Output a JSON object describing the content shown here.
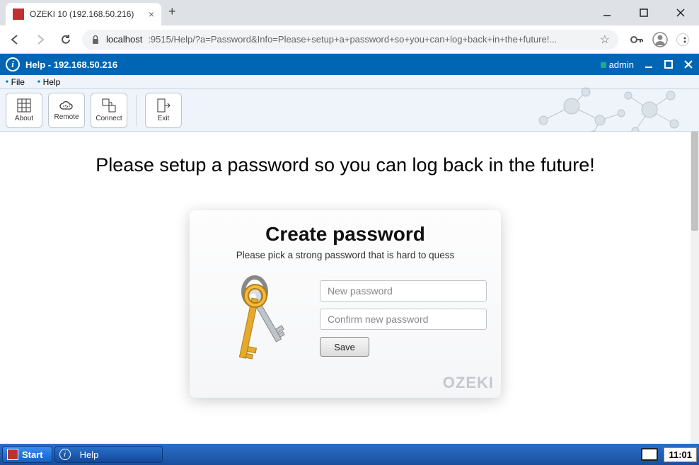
{
  "browser": {
    "tab_title": "OZEKI 10 (192.168.50.216)",
    "url_host": "localhost",
    "url_port": ":9515",
    "url_path": "/Help/?a=Password&Info=Please+setup+a+password+so+you+can+log+back+in+the+future!..."
  },
  "app_header": {
    "title": "Help - 192.168.50.216",
    "user": "admin"
  },
  "menu": {
    "file": "File",
    "help": "Help"
  },
  "toolbar": {
    "about": "About",
    "remote": "Remote",
    "connect": "Connect",
    "exit": "Exit"
  },
  "page": {
    "headline": "Please setup a password so you can log back in the future!",
    "card_title": "Create password",
    "card_subtitle": "Please pick a strong password that is hard to quess",
    "new_password_placeholder": "New password",
    "confirm_password_placeholder": "Confirm new password",
    "save_label": "Save",
    "watermark": "OZEKI"
  },
  "taskbar": {
    "start": "Start",
    "help": "Help",
    "clock": "11:01"
  }
}
